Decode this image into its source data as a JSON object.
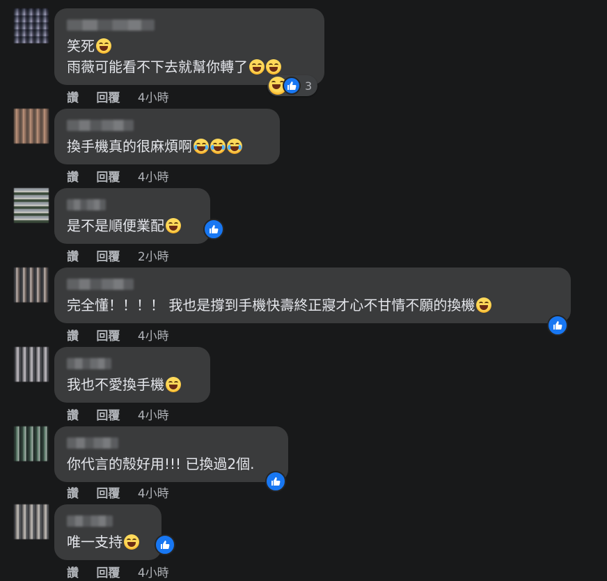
{
  "colors": {
    "background": "#18191a",
    "bubble": "#3a3b3c",
    "like": "#1877f2",
    "meta_text": "#b0b3b8"
  },
  "action_labels": {
    "like": "讚",
    "reply": "回覆"
  },
  "comments": [
    {
      "text_lines": [
        "笑死",
        "雨薇可能看不下去就幫你轉了"
      ],
      "time": "4小時",
      "reaction_count": "3"
    },
    {
      "text_lines": [
        "換手機真的很麻煩啊"
      ],
      "time": "4小時"
    },
    {
      "text_lines": [
        "是不是順便業配"
      ],
      "time": "2小時"
    },
    {
      "text_lines": [
        "完全懂！！！！ 我也是撐到手機快壽終正寢才心不甘情不願的換機"
      ],
      "time": "4小時"
    },
    {
      "text_lines": [
        "我也不愛換手機"
      ],
      "time": "4小時"
    },
    {
      "text_lines": [
        "你代言的殼好用!!! 已換過2個."
      ],
      "time": "4小時"
    },
    {
      "text_lines": [
        "唯一支持"
      ],
      "time": "4小時"
    }
  ],
  "icons": [
    "grinning-squint-emoji",
    "tears-of-joy-emoji",
    "crying-emoji",
    "rofl-emoji",
    "smiling-emoji",
    "like-icon"
  ]
}
